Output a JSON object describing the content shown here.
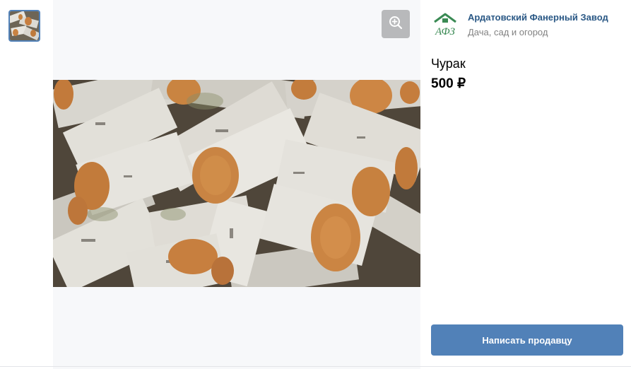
{
  "seller": {
    "name": "Ардатовский Фанерный Завод",
    "category": "Дача, сад и огород",
    "logo_icon": "afz-logo-icon",
    "logo_text": "АФЗ"
  },
  "product": {
    "title": "Чурак",
    "price": "500 ₽"
  },
  "actions": {
    "contact_label": "Написать продавцу",
    "zoom_icon": "zoom-in-icon"
  },
  "colors": {
    "accent": "#5181b8",
    "link": "#2a5885",
    "logo_green": "#3a8a54"
  }
}
